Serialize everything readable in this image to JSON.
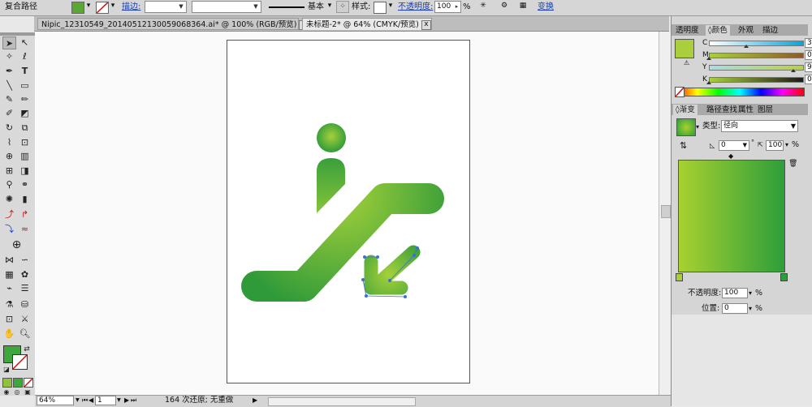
{
  "control_bar": {
    "selection_label": "复合路径",
    "stroke_label": "描边:",
    "profile_label": "基本",
    "style_label": "样式:",
    "opacity_label": "不透明度:",
    "opacity_value": "100",
    "opacity_unit": "%",
    "transform_label": "变换",
    "fill_color": "#5aa833"
  },
  "tabs": [
    {
      "label": "Nipic_12310549_20140512130059068364.ai* @ 100% (RGB/预览)",
      "close": "x",
      "active": false
    },
    {
      "label": "未标题-2* @ 64% (CMYK/预览)",
      "close": "x",
      "active": true
    }
  ],
  "status_bar": {
    "zoom": "64%",
    "page": "1",
    "history": "164 次还原; 无重做"
  },
  "color_panel": {
    "tabs": [
      "透明度",
      "颜色",
      "外观",
      "描边"
    ],
    "active_tab": "颜色",
    "swatch_color": "#a9cf3c",
    "sliders": [
      {
        "label": "C",
        "value": "39.61",
        "unit": "%",
        "level": 0.3961
      },
      {
        "label": "M",
        "value": "0",
        "unit": "%",
        "level": 0
      },
      {
        "label": "Y",
        "value": "90.2",
        "unit": "%",
        "level": 0.902
      },
      {
        "label": "K",
        "value": "0",
        "unit": "%",
        "level": 0
      }
    ]
  },
  "gradient_panel": {
    "tabs": [
      "渐变",
      "路径查找",
      "属性",
      "图层"
    ],
    "active_tab": "渐变",
    "type_label": "类型:",
    "type_value": "径向",
    "angle_value": "0",
    "angle_unit": "°",
    "aspect_value": "100",
    "aspect_unit": "%",
    "opacity_label": "不透明度:",
    "opacity_value": "100",
    "opacity_unit": "%",
    "location_label": "位置:",
    "location_value": "0",
    "location_unit": "%",
    "start_color": "#a8d130",
    "end_color": "#2d9e3a"
  },
  "artwork": {
    "light_green": "#a6d13a",
    "dark_green": "#2f9a39"
  }
}
